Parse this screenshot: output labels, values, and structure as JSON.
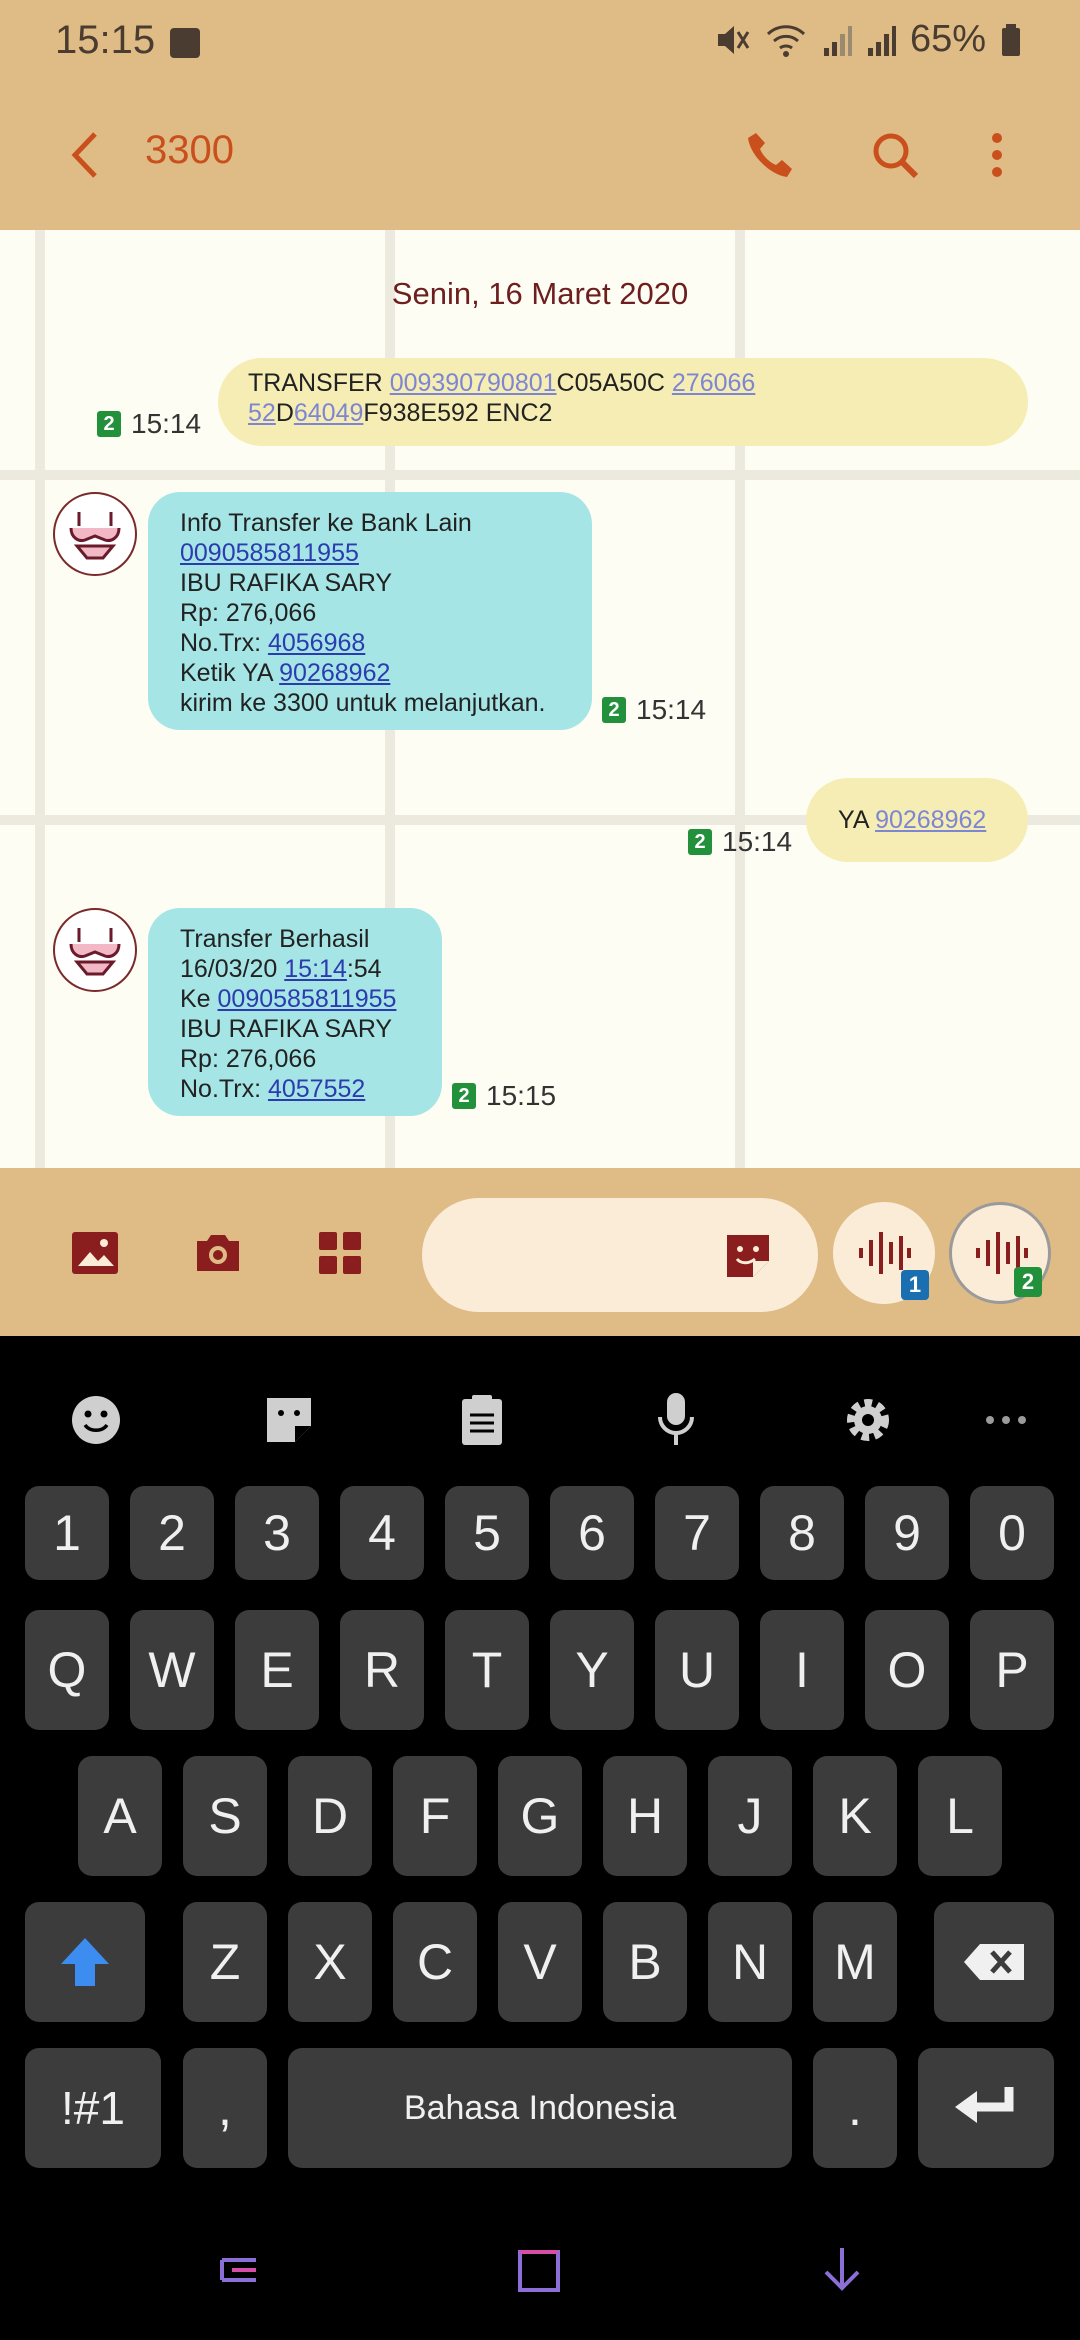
{
  "status": {
    "time": "15:15",
    "battery": "65%"
  },
  "header": {
    "title": "3300"
  },
  "conversation": {
    "date": "Senin, 16 Maret 2020",
    "messages": [
      {
        "dir": "out",
        "time": "15:14",
        "sim": "2",
        "l1": {
          "a": "TRANSFER ",
          "b": "009390790801",
          "c": "C05A50C ",
          "d": "276066"
        },
        "l2": {
          "a": "52",
          "b": "D",
          "c": "64049",
          "d": "F938E592 ENC2"
        }
      },
      {
        "dir": "in",
        "time": "15:14",
        "sim": "2",
        "lines": {
          "title": "Info Transfer ke Bank Lain",
          "acct": "0090585811955",
          "name": "IBU RAFIKA  SARY",
          "amount": "Rp: 276,066",
          "trx_label": "No.Trx: ",
          "trx": "4056968",
          "ketik_label": "Ketik YA ",
          "code": "90268962",
          "footer": "kirim ke 3300 untuk melanjutkan."
        }
      },
      {
        "dir": "out",
        "time": "15:14",
        "sim": "2",
        "text": "YA ",
        "code": "90268962"
      },
      {
        "dir": "in",
        "time": "15:15",
        "sim": "2",
        "lines": {
          "title": "Transfer Berhasil",
          "date": "16/03/20 ",
          "time_link": "15:14",
          "secs": ":54",
          "ke_label": "Ke ",
          "acct": "0090585811955",
          "name": "IBU RAFIKA  SARY",
          "amount": "Rp: 276,066",
          "trx_label": "No.Trx: ",
          "trx": "4057552"
        }
      }
    ]
  },
  "composer": {
    "placeholder": "",
    "sim1": "1",
    "sim2": "2"
  },
  "keyboard": {
    "num_row": [
      "1",
      "2",
      "3",
      "4",
      "5",
      "6",
      "7",
      "8",
      "9",
      "0"
    ],
    "row1": [
      "Q",
      "W",
      "E",
      "R",
      "T",
      "Y",
      "U",
      "I",
      "O",
      "P"
    ],
    "row2": [
      "A",
      "S",
      "D",
      "F",
      "G",
      "H",
      "J",
      "K",
      "L"
    ],
    "row3": [
      "Z",
      "X",
      "C",
      "V",
      "B",
      "N",
      "M"
    ],
    "symbols": "!#1",
    "comma": ",",
    "space": "Bahasa Indonesia",
    "period": "."
  },
  "colors": {
    "appbar": "#dfbc86",
    "accent": "#c9501c",
    "bubble_in": "#a6e5e5",
    "bubble_out": "#f6edb4",
    "sim": "#23903c"
  }
}
